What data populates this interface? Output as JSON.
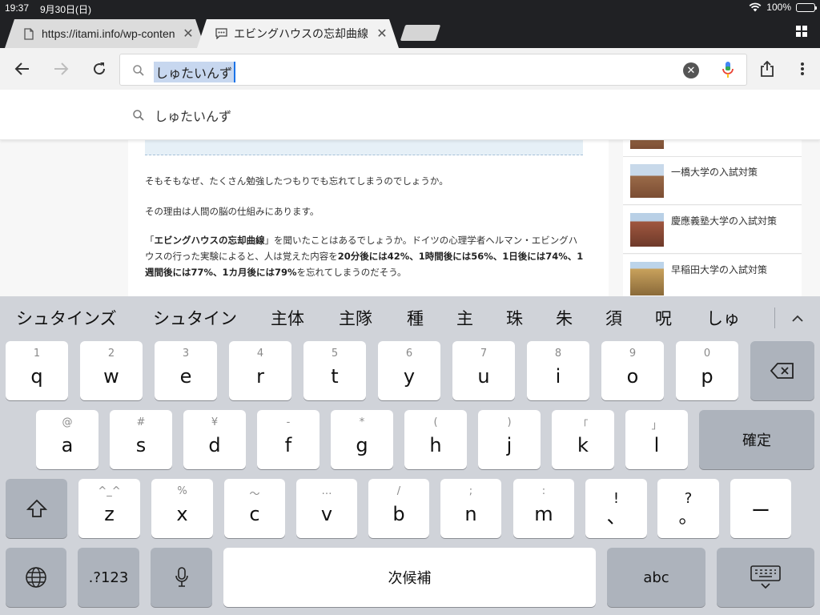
{
  "status_bar": {
    "time": "19:37",
    "date": "9月30日(日)",
    "battery": "100%"
  },
  "tabs": [
    {
      "title": "https://itami.info/wp-conten",
      "icon": "page-icon"
    },
    {
      "title": "エビングハウスの忘却曲線",
      "icon": "comment-icon"
    }
  ],
  "omnibox": {
    "text": "しゅたいんず"
  },
  "suggestion": {
    "text": "しゅたいんず"
  },
  "article": {
    "p1": "そもそもなぜ、たくさん勉強したつもりでも忘れてしまうのでしょうか。",
    "p2": "その理由は人間の脳の仕組みにあります。",
    "p3": {
      "a": "「",
      "b": "エビングハウスの忘却曲線",
      "c": "」を聞いたことはあるでしょうか。ドイツの心理学者ヘルマン・エビングハウスの行った実験によると、人は覚えた内容を",
      "d": "20分後には42%、1時間後には56%、1日後には74%、1週間後には77%、1カ月後には79%",
      "e": "を忘れてしまうのだそう。"
    }
  },
  "sidebar": [
    {
      "title": "一橋大学の入試対策"
    },
    {
      "title": "慶應義塾大学の入試対策"
    },
    {
      "title": "早稲田大学の入試対策"
    }
  ],
  "keyboard": {
    "candidates": [
      "シュタインズ",
      "シュタイン",
      "主体",
      "主隊",
      "種",
      "主",
      "珠",
      "朱",
      "須",
      "呪",
      "しゅ"
    ],
    "row1": [
      {
        "hint": "1",
        "key": "q"
      },
      {
        "hint": "2",
        "key": "w"
      },
      {
        "hint": "3",
        "key": "e"
      },
      {
        "hint": "4",
        "key": "r"
      },
      {
        "hint": "5",
        "key": "t"
      },
      {
        "hint": "6",
        "key": "y"
      },
      {
        "hint": "7",
        "key": "u"
      },
      {
        "hint": "8",
        "key": "i"
      },
      {
        "hint": "9",
        "key": "o"
      },
      {
        "hint": "0",
        "key": "p"
      }
    ],
    "row2": [
      {
        "hint": "@",
        "key": "a"
      },
      {
        "hint": "#",
        "key": "s"
      },
      {
        "hint": "¥",
        "key": "d"
      },
      {
        "hint": "-",
        "key": "f"
      },
      {
        "hint": "*",
        "key": "g"
      },
      {
        "hint": "(",
        "key": "h"
      },
      {
        "hint": ")",
        "key": "j"
      },
      {
        "hint": "「",
        "key": "k"
      },
      {
        "hint": "」",
        "key": "l"
      }
    ],
    "row3": [
      {
        "hint": "^_^",
        "key": "z"
      },
      {
        "hint": "%",
        "key": "x"
      },
      {
        "hint": "〜",
        "key": "c"
      },
      {
        "hint": "…",
        "key": "v"
      },
      {
        "hint": "/",
        "key": "b"
      },
      {
        "hint": ";",
        "key": "n"
      },
      {
        "hint": ":",
        "key": "m"
      },
      {
        "hint": "!",
        "key": "、"
      },
      {
        "hint": "?",
        "key": "。"
      },
      {
        "hint": "",
        "key": "ー"
      }
    ],
    "confirm_label": "確定",
    "numbers_label": ".?123",
    "space_label": "次候補",
    "abc_label": "abc"
  }
}
